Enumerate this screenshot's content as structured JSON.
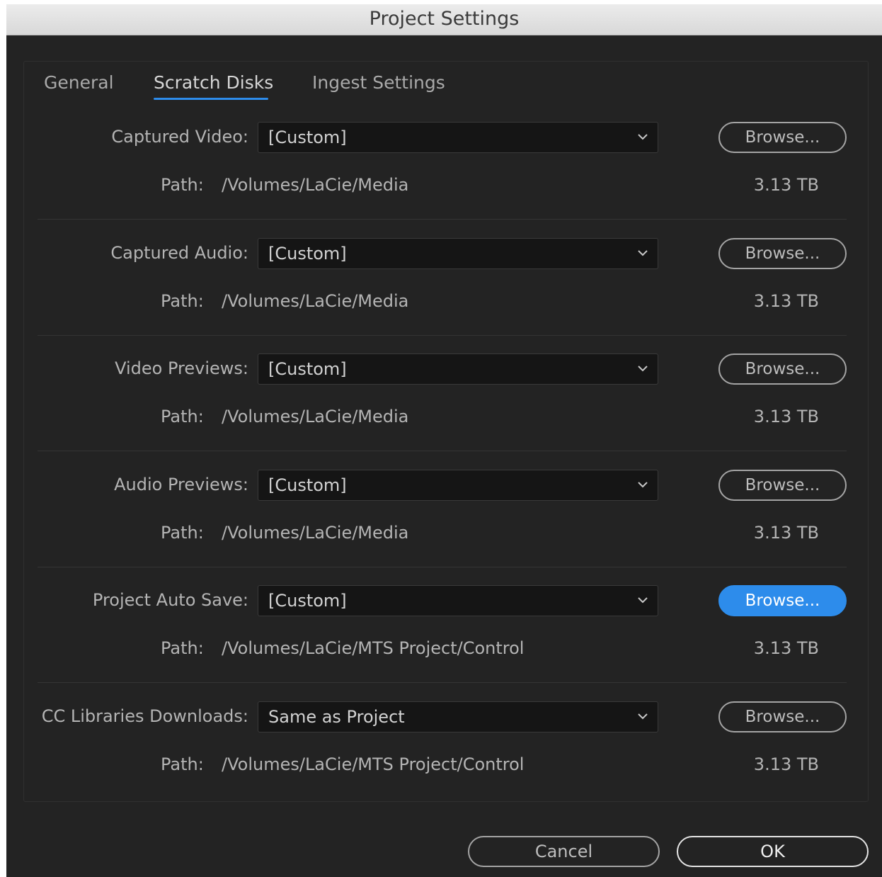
{
  "window": {
    "title": "Project Settings"
  },
  "tabs": [
    {
      "label": "General",
      "active": false
    },
    {
      "label": "Scratch Disks",
      "active": true
    },
    {
      "label": "Ingest Settings",
      "active": false
    }
  ],
  "path_label": "Path:",
  "rows": [
    {
      "label": "Captured Video:",
      "value": "[Custom]",
      "button": "Browse...",
      "path": "/Volumes/LaCie/Media",
      "size": "3.13 TB"
    },
    {
      "label": "Captured Audio:",
      "value": "[Custom]",
      "button": "Browse...",
      "path": "/Volumes/LaCie/Media",
      "size": "3.13 TB"
    },
    {
      "label": "Video Previews:",
      "value": "[Custom]",
      "button": "Browse...",
      "path": "/Volumes/LaCie/Media",
      "size": "3.13 TB"
    },
    {
      "label": "Audio Previews:",
      "value": "[Custom]",
      "button": "Browse...",
      "path": "/Volumes/LaCie/Media",
      "size": "3.13 TB"
    },
    {
      "label": "Project Auto Save:",
      "value": "[Custom]",
      "button": "Browse...",
      "path": "/Volumes/LaCie/MTS Project/Control",
      "size": "3.13 TB",
      "focused": true
    },
    {
      "label": "CC Libraries Downloads:",
      "value": "Same as Project",
      "button": "Browse...",
      "path": "/Volumes/LaCie/MTS Project/Control",
      "size": "3.13 TB"
    }
  ],
  "footer": {
    "cancel_label": "Cancel",
    "ok_label": "OK"
  },
  "colors": {
    "accent": "#2d8ceb",
    "background": "#232323",
    "field": "#151515"
  }
}
